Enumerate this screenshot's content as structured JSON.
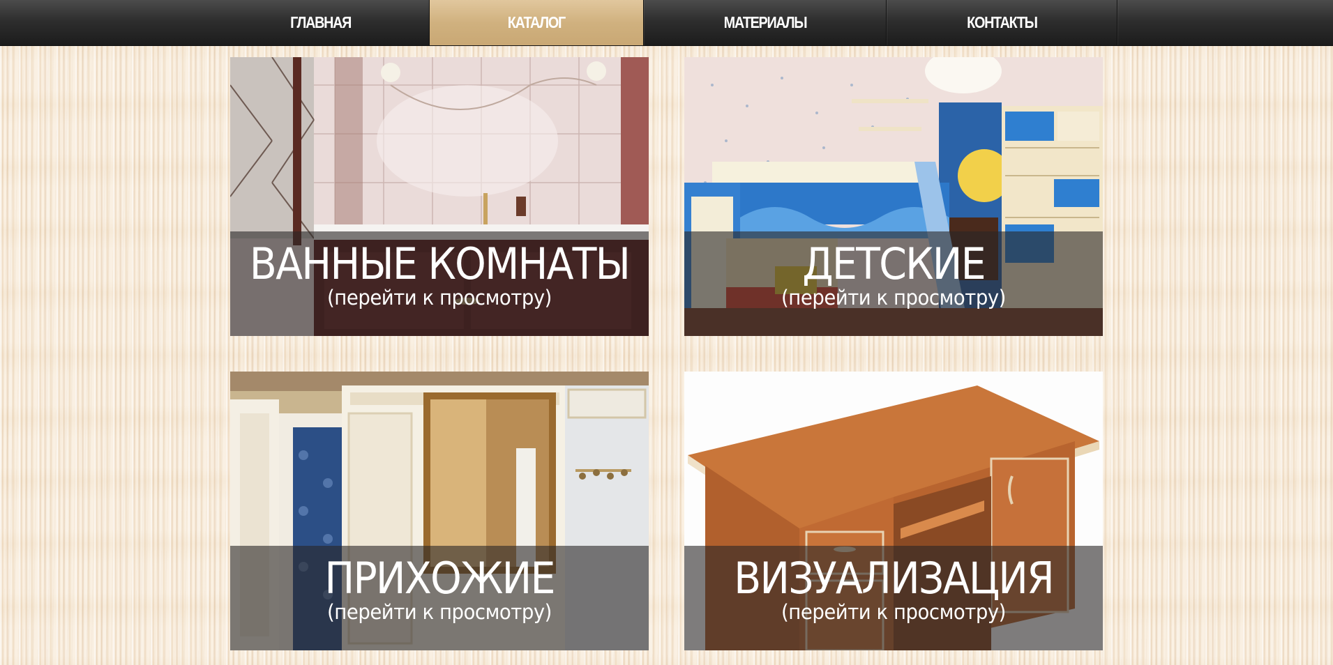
{
  "nav": {
    "items": [
      {
        "label": "ГЛАВНАЯ",
        "active": false
      },
      {
        "label": "КАТАЛОГ",
        "active": true
      },
      {
        "label": "МАТЕРИАЛЫ",
        "active": false
      },
      {
        "label": "КОНТАКТЫ",
        "active": false
      }
    ],
    "active_color": "#d0b17f",
    "bar_color": "#2e2e2e"
  },
  "catalog": {
    "tiles": [
      {
        "title": "ВАННЫЕ КОМНАТЫ",
        "subtitle": "(перейти к просмотру)",
        "image": "bathroom-photo"
      },
      {
        "title": "ДЕТСКИЕ",
        "subtitle": "(перейти к просмотру)",
        "image": "kids-room-photo"
      },
      {
        "title": "ПРИХОЖИЕ",
        "subtitle": "(перейти к просмотру)",
        "image": "hallway-photo"
      },
      {
        "title": "ВИЗУАЛИЗАЦИЯ",
        "subtitle": "(перейти к просмотру)",
        "image": "desk-render-photo"
      }
    ]
  }
}
